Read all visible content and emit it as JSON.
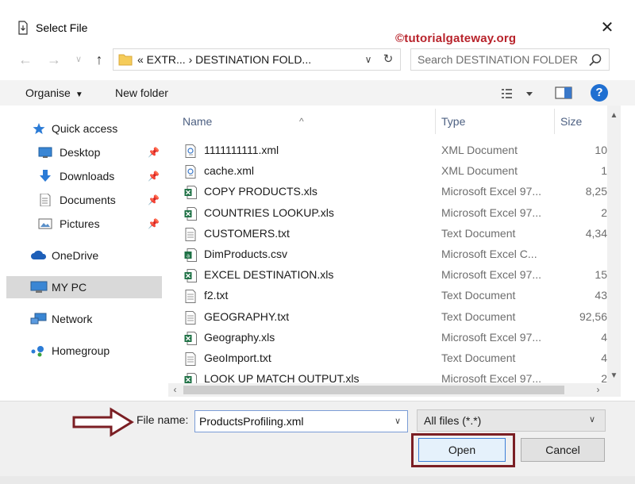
{
  "window": {
    "title": "Select File",
    "watermark": "©tutorialgateway.org",
    "close_glyph": "✕"
  },
  "address": {
    "path_text": "« EXTR...  ›  DESTINATION FOLD...",
    "search_placeholder": "Search DESTINATION FOLDER"
  },
  "toolbar": {
    "organise_label": "Organise",
    "new_folder_label": "New folder",
    "help_label": "?"
  },
  "sidebar": {
    "items": [
      {
        "label": "Quick access",
        "icon": "star-icon"
      },
      {
        "label": "Desktop",
        "icon": "desktop-icon",
        "pinned": true
      },
      {
        "label": "Downloads",
        "icon": "download-icon",
        "pinned": true
      },
      {
        "label": "Documents",
        "icon": "documents-icon",
        "pinned": true
      },
      {
        "label": "Pictures",
        "icon": "pictures-icon",
        "pinned": true
      },
      {
        "label": "OneDrive",
        "icon": "cloud-icon"
      },
      {
        "label": "MY PC",
        "icon": "computer-icon",
        "selected": true
      },
      {
        "label": "Network",
        "icon": "network-icon"
      },
      {
        "label": "Homegroup",
        "icon": "homegroup-icon"
      }
    ]
  },
  "columns": {
    "name": "Name",
    "type": "Type",
    "size": "Size"
  },
  "files": [
    {
      "name": "1111111111.xml",
      "type": "XML Document",
      "size": "10",
      "kind": "xml"
    },
    {
      "name": "cache.xml",
      "type": "XML Document",
      "size": "1",
      "kind": "xml"
    },
    {
      "name": "COPY PRODUCTS.xls",
      "type": "Microsoft Excel 97...",
      "size": "8,25",
      "kind": "xls"
    },
    {
      "name": "COUNTRIES LOOKUP.xls",
      "type": "Microsoft Excel 97...",
      "size": "2",
      "kind": "xls"
    },
    {
      "name": "CUSTOMERS.txt",
      "type": "Text Document",
      "size": "4,34",
      "kind": "txt"
    },
    {
      "name": "DimProducts.csv",
      "type": "Microsoft Excel C...",
      "size": "",
      "kind": "csv"
    },
    {
      "name": "EXCEL DESTINATION.xls",
      "type": "Microsoft Excel 97...",
      "size": "15",
      "kind": "xls"
    },
    {
      "name": "f2.txt",
      "type": "Text Document",
      "size": "43",
      "kind": "txt"
    },
    {
      "name": "GEOGRAPHY.txt",
      "type": "Text Document",
      "size": "92,56",
      "kind": "txt"
    },
    {
      "name": "Geography.xls",
      "type": "Microsoft Excel 97...",
      "size": "4",
      "kind": "xls"
    },
    {
      "name": "GeoImport.txt",
      "type": "Text Document",
      "size": "4",
      "kind": "txt"
    },
    {
      "name": "LOOK UP MATCH OUTPUT.xls",
      "type": "Microsoft Excel 97...",
      "size": "2",
      "kind": "xls"
    }
  ],
  "bottom": {
    "file_name_label": "File name:",
    "file_name_value": "ProductsProfiling.xml",
    "file_type_value": "All files (*.*)",
    "open_label": "Open",
    "cancel_label": "Cancel"
  },
  "colors": {
    "accent": "#1f6fd1",
    "annotation": "#7b1f24",
    "watermark": "#b8232b",
    "selected_nav": "#d9d9d9",
    "excel_green": "#1e7145"
  }
}
